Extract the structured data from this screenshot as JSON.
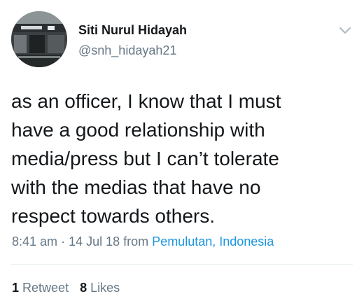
{
  "tweet": {
    "author": {
      "name": "Siti Nurul Hidayah",
      "handle": "@snh_hidayah21",
      "avatar_icon": "avatar-photo-storefront"
    },
    "menu_icon": "chevron-down-icon",
    "text_lines": [
      "as an officer, I know that I must",
      "have a good relationship with",
      "media/press but I can’t tolerate",
      "with the medias that have no",
      "respect towards others."
    ],
    "meta": {
      "time": "8:41 am",
      "separator": "·",
      "date": "14 Jul 18",
      "from": "from",
      "place": "Pemulutan, Indonesia"
    },
    "stats": {
      "retweets_count": "1",
      "retweets_label": "Retweet",
      "likes_count": "8",
      "likes_label": "Likes"
    }
  },
  "colors": {
    "text": "#14171a",
    "muted": "#657786",
    "link": "#1b95e0",
    "divider": "#e6ecf0"
  }
}
